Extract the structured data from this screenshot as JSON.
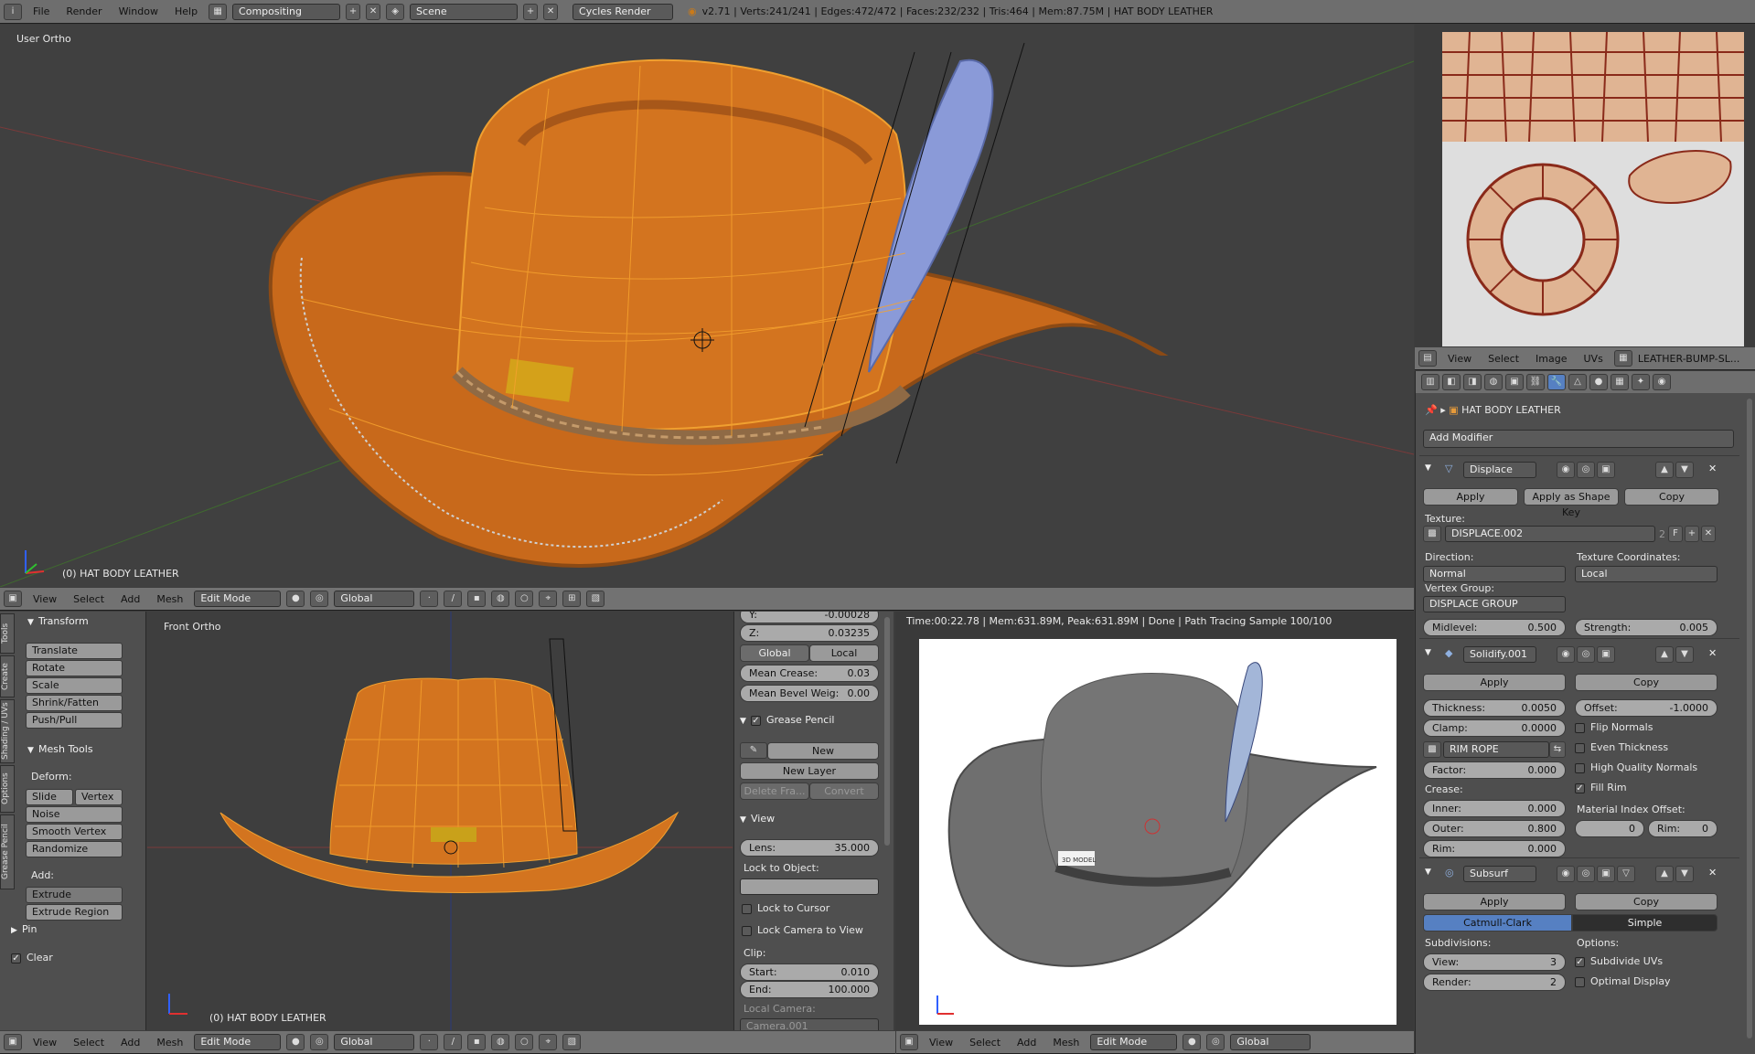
{
  "top_bar": {
    "menus": [
      "File",
      "Render",
      "Window",
      "Help"
    ],
    "layout": "Compositing",
    "scene": "Scene",
    "engine": "Cycles Render",
    "stats": "v2.71 | Verts:241/241 | Edges:472/472 | Faces:232/232 | Tris:464 | Mem:87.75M | HAT BODY LEATHER"
  },
  "main_view": {
    "view_label": "User Ortho",
    "object_label": "(0) HAT BODY LEATHER"
  },
  "main_header": {
    "menus": [
      "View",
      "Select",
      "Add",
      "Mesh"
    ],
    "mode": "Edit Mode",
    "orientation": "Global"
  },
  "tool_shelf": {
    "tabs": [
      "Tools",
      "Create",
      "Shading / UVs",
      "Options",
      "Grease Pencil"
    ],
    "transform_title": "Transform",
    "transform_buttons": [
      "Translate",
      "Rotate",
      "Scale",
      "Shrink/Fatten",
      "Push/Pull"
    ],
    "mesh_tools_title": "Mesh Tools",
    "deform_label": "Deform:",
    "slide_edge": "Slide Ed",
    "vertex": "Vertex",
    "deform_buttons": [
      "Noise",
      "Smooth Vertex",
      "Randomize"
    ],
    "add_label": "Add:",
    "extrude": "Extrude",
    "extrude_region": "Extrude Region",
    "pin_title": "Pin",
    "clear": "Clear"
  },
  "front_view": {
    "view_label": "Front Ortho",
    "object_label": "(0) HAT BODY LEATHER"
  },
  "properties_n": {
    "y_label": "Y:",
    "y_value": "-0.00028",
    "z_label": "Z:",
    "z_value": "0.03235",
    "global": "Global",
    "local": "Local",
    "mean_crease_label": "Mean Crease:",
    "mean_crease": "0.03",
    "mean_bevel_label": "Mean Bevel Weig:",
    "mean_bevel": "0.00",
    "grease_pencil": "Grease Pencil",
    "new": "New",
    "new_layer": "New Layer",
    "delete_frame": "Delete Fra...",
    "convert": "Convert",
    "view_title": "View",
    "lens_label": "Lens:",
    "lens": "35.000",
    "lock_to_object": "Lock to Object:",
    "lock_to_cursor": "Lock to Cursor",
    "lock_camera": "Lock Camera to View",
    "clip": "Clip:",
    "start_label": "Start:",
    "start": "0.010",
    "end_label": "End:",
    "end": "100.000",
    "local_camera": "Local Camera:",
    "camera": "Camera.001"
  },
  "render_view": {
    "status": "Time:00:22.78 | Mem:631.89M, Peak:631.89M | Done | Path Tracing Sample 100/100",
    "tag_text": "3D MODEL"
  },
  "uv_header": {
    "menus": [
      "View",
      "Select",
      "Image",
      "UVs"
    ],
    "image": "LEATHER-BUMP-SL..."
  },
  "modifier_panel": {
    "object": "HAT BODY LEATHER",
    "add_modifier": "Add Modifier",
    "displace": {
      "name": "Displace",
      "apply": "Apply",
      "apply_shape": "Apply as Shape Key",
      "copy": "Copy",
      "texture_label": "Texture:",
      "texture": "DISPLACE.002",
      "texture_users": "2",
      "fake": "F",
      "direction_label": "Direction:",
      "direction": "Normal",
      "coords_label": "Texture Coordinates:",
      "coords": "Local",
      "vgroup_label": "Vertex Group:",
      "vgroup": "DISPLACE GROUP",
      "midlevel_label": "Midlevel:",
      "midlevel": "0.500",
      "strength_label": "Strength:",
      "strength": "0.005"
    },
    "solidify": {
      "name": "Solidify.001",
      "apply": "Apply",
      "copy": "Copy",
      "thickness_label": "Thickness:",
      "thickness": "0.0050",
      "offset_label": "Offset:",
      "offset": "-1.0000",
      "clamp_label": "Clamp:",
      "clamp": "0.0000",
      "flip_normals": "Flip Normals",
      "even_thickness": "Even Thickness",
      "hq_normals": "High Quality Normals",
      "fill_rim": "Fill Rim",
      "vgroup": "RIM ROPE",
      "factor_label": "Factor:",
      "factor": "0.000",
      "crease_label": "Crease:",
      "inner_label": "Inner:",
      "inner": "0.000",
      "outer_label": "Outer:",
      "outer": "0.800",
      "rim_label": "Rim:",
      "rim": "0.000",
      "mat_offset_label": "Material Index Offset:",
      "mat_offset": "0",
      "mat_rim_label": "Rim:",
      "mat_rim": "0"
    },
    "subsurf": {
      "name": "Subsurf",
      "apply": "Apply",
      "copy": "Copy",
      "catmull": "Catmull-Clark",
      "simple": "Simple",
      "subdivisions_label": "Subdivisions:",
      "view_label": "View:",
      "view": "3",
      "render_label": "Render:",
      "render": "2",
      "options_label": "Options:",
      "subdivide_uvs": "Subdivide UVs",
      "optimal_display": "Optimal Display"
    }
  }
}
